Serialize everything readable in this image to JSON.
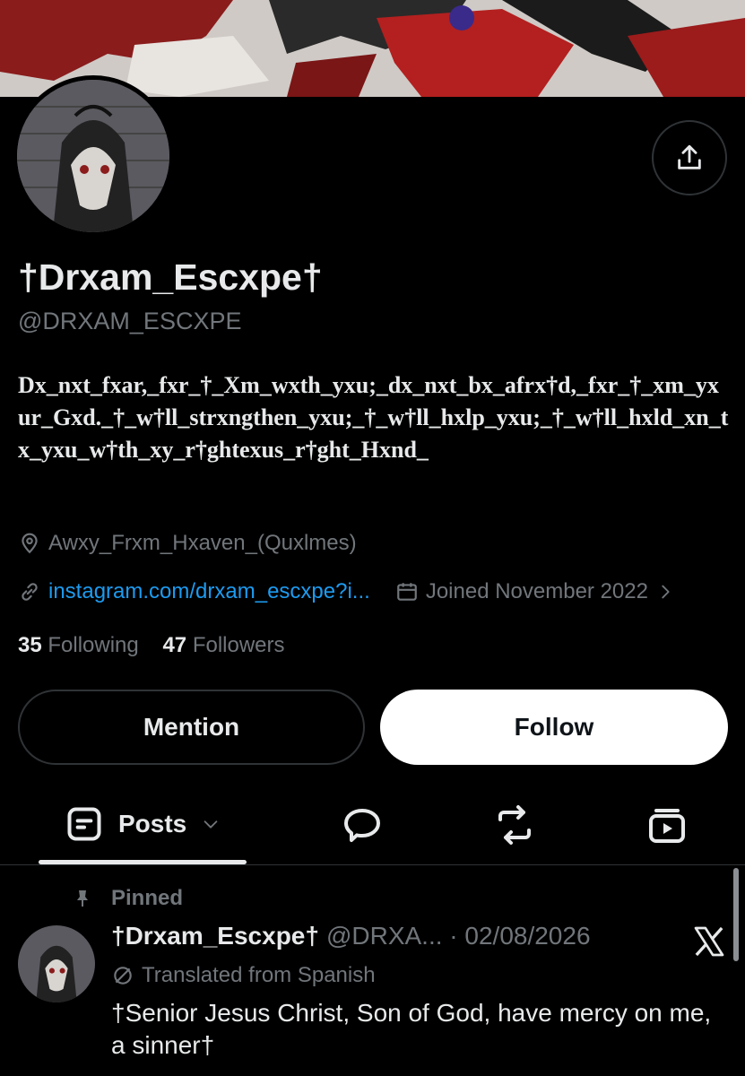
{
  "profile": {
    "display_name": "†Drxam_Escxpe†",
    "handle": "@DRXAM_ESCXPE",
    "bio": "Dx_nxt_fxar,_fxr_†_Xm_wxth_yxu;_dx_nxt_bx_afrx†d,_fxr_†_xm_yxur_Gxd._†_w†ll_strxngthen_yxu;_†_w†ll_hxlp_yxu;_†_w†ll_hxld_xn_tx_yxu_w†th_xy_r†ghtexus_r†ght_Hxnd_",
    "location": "Awxy_Frxm_Hxaven_(Quxlmes)",
    "link": "instagram.com/drxam_escxpe?i...",
    "joined": "Joined November 2022",
    "following_count": "35",
    "following_label": "Following",
    "followers_count": "47",
    "followers_label": "Followers"
  },
  "actions": {
    "mention_label": "Mention",
    "follow_label": "Follow"
  },
  "tabs": {
    "posts_label": "Posts"
  },
  "pinned_post": {
    "pinned_label": "Pinned",
    "author_name": "†Drxam_Escxpe†",
    "author_handle_date": "@DRXA... · 02/08/2026",
    "translated_label": "Translated from Spanish",
    "text": "†Senior Jesus Christ, Son of God, have mercy on me, a sinner†"
  },
  "colors": {
    "background": "#000000",
    "text_primary": "#e7e9ea",
    "text_secondary": "#71767b",
    "link": "#1d9bf0",
    "border": "#2f3336"
  },
  "icons": [
    "share-icon",
    "location-icon",
    "link-icon",
    "calendar-icon",
    "chevron-right-icon",
    "posts-icon",
    "chevron-down-icon",
    "replies-icon",
    "reposts-icon",
    "media-icon",
    "pin-icon",
    "translate-icon",
    "x-logo-icon"
  ]
}
